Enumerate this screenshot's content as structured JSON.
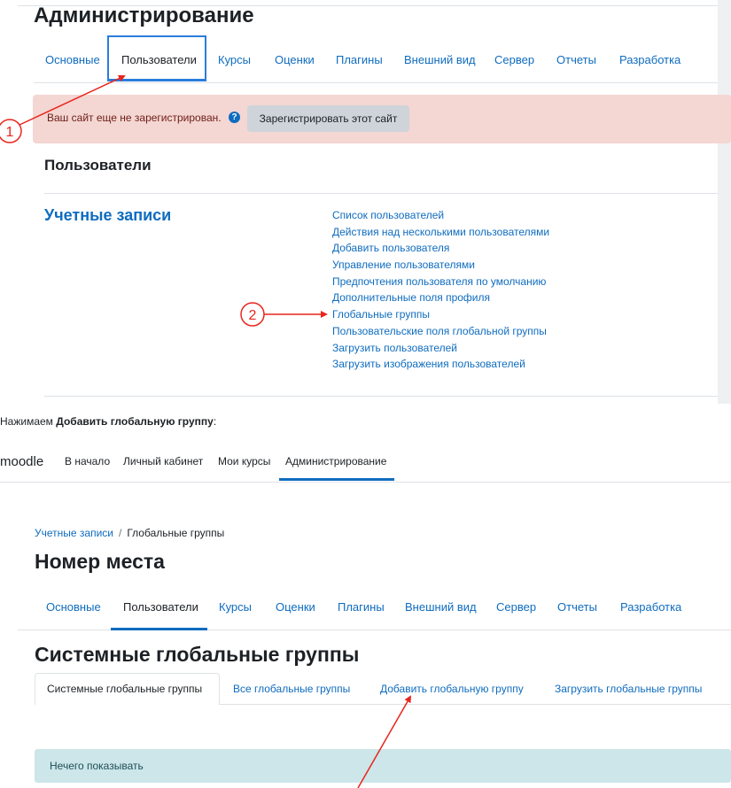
{
  "top": {
    "title": "Администрирование",
    "tabs": [
      "Основные",
      "Пользователи",
      "Курсы",
      "Оценки",
      "Плагины",
      "Внешний вид",
      "Сервер",
      "Отчеты",
      "Разработка"
    ],
    "alert": {
      "text": "Ваш сайт еще не зарегистрирован.",
      "help_icon": "?",
      "button": "Зарегистрировать этот сайт"
    },
    "section_title": "Пользователи",
    "accounts": {
      "heading": "Учетные записи",
      "links": [
        "Список пользователей",
        "Действия над несколькими пользователями",
        "Добавить пользователя",
        "Управление пользователями",
        "Предпочтения пользователя по умолчанию",
        "Дополнительные поля профиля",
        "Глобальные группы",
        "Пользовательские поля глобальной группы",
        "Загрузить пользователей",
        "Загрузить изображения пользователей"
      ]
    }
  },
  "caption": {
    "prefix": "Нажимаем ",
    "bold": "Добавить глобальную группу",
    "suffix": ":"
  },
  "bottom": {
    "logo": "moodle",
    "nav": [
      "В начало",
      "Личный кабинет",
      "Мои курсы",
      "Администрирование"
    ],
    "breadcrumb": {
      "link": "Учетные записи",
      "separator": "/",
      "current": "Глобальные группы"
    },
    "title": "Номер места",
    "tabs": [
      "Основные",
      "Пользователи",
      "Курсы",
      "Оценки",
      "Плагины",
      "Внешний вид",
      "Сервер",
      "Отчеты",
      "Разработка"
    ],
    "heading": "Системные глобальные группы",
    "subtabs": [
      "Системные глобальные группы",
      "Все глобальные группы",
      "Добавить глобальную группу",
      "Загрузить глобальные группы"
    ],
    "empty_message": "Нечего показывать"
  },
  "annotations": {
    "badge_1": "1",
    "badge_2": "2",
    "color": "#e8251c"
  }
}
